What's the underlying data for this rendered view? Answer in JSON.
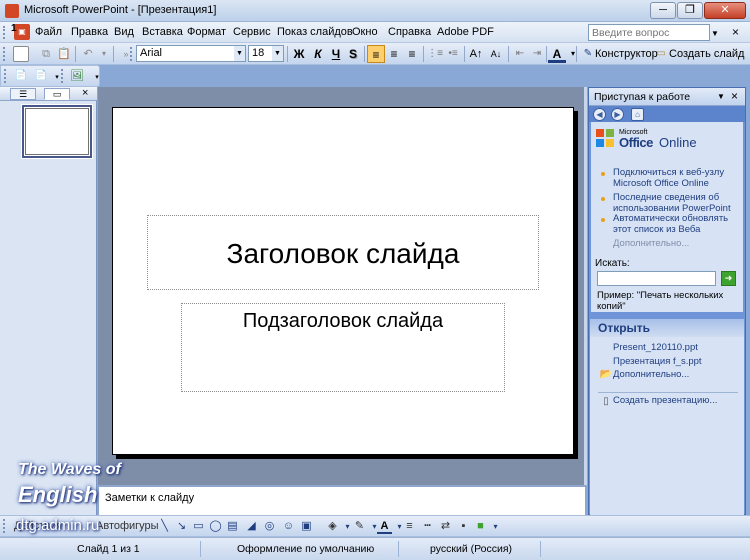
{
  "window": {
    "title": "Microsoft PowerPoint - [Презентация1]",
    "min_label": "─",
    "max_label": "❐",
    "close_label": "✕"
  },
  "menu": {
    "items": [
      "Файл",
      "Правка",
      "Вид",
      "Вставка",
      "Формат",
      "Сервис",
      "Показ слайдов",
      "Окно",
      "Справка",
      "Adobe PDF"
    ],
    "question_placeholder": "Введите вопрос",
    "doc_close": "×"
  },
  "toolbar": {
    "font": "Arial",
    "size": "18",
    "bold": "Ж",
    "italic": "К",
    "underline": "Ч",
    "shadow": "S",
    "designer": "Конструктор",
    "new_slide": "Создать слайд",
    "font_color": "A"
  },
  "left_pane": {
    "close": "×",
    "slide_number": "1"
  },
  "slide": {
    "title": "Заголовок слайда",
    "subtitle": "Подзаголовок слайда"
  },
  "notes": {
    "placeholder": "Заметки к слайду"
  },
  "task_pane": {
    "title": "Приступая к работе",
    "logo_ms": "Microsoft",
    "logo_office": "Office",
    "logo_online": "Online",
    "links": [
      "Подключиться к веб-узлу Microsoft Office Online",
      "Последние сведения об использовании PowerPoint",
      "Автоматически обновлять этот список из Веба"
    ],
    "more": "Дополнительно...",
    "search_label": "Искать:",
    "example": "Пример:  \"Печать нескольких копий\"",
    "open_header": "Открыть",
    "recent_files": [
      "Present_120110.ppt",
      "Презентация f_s.ppt"
    ],
    "open_more": "Дополнительно...",
    "create": "Создать презентацию..."
  },
  "drawbar": {
    "actions": "Действия",
    "autoshapes": "Автофигуры"
  },
  "status": {
    "slide": "Слайд 1 из 1",
    "design": "Оформление по умолчанию",
    "language": "русский (Россия)"
  },
  "watermark": {
    "line1": "The Waves of",
    "line2": "English",
    "line3": "dtg.admin.ru"
  },
  "colors": {
    "accent": "#1f3e80",
    "taskpane": "#6f95d8",
    "active_button": "#ffcf6e"
  }
}
